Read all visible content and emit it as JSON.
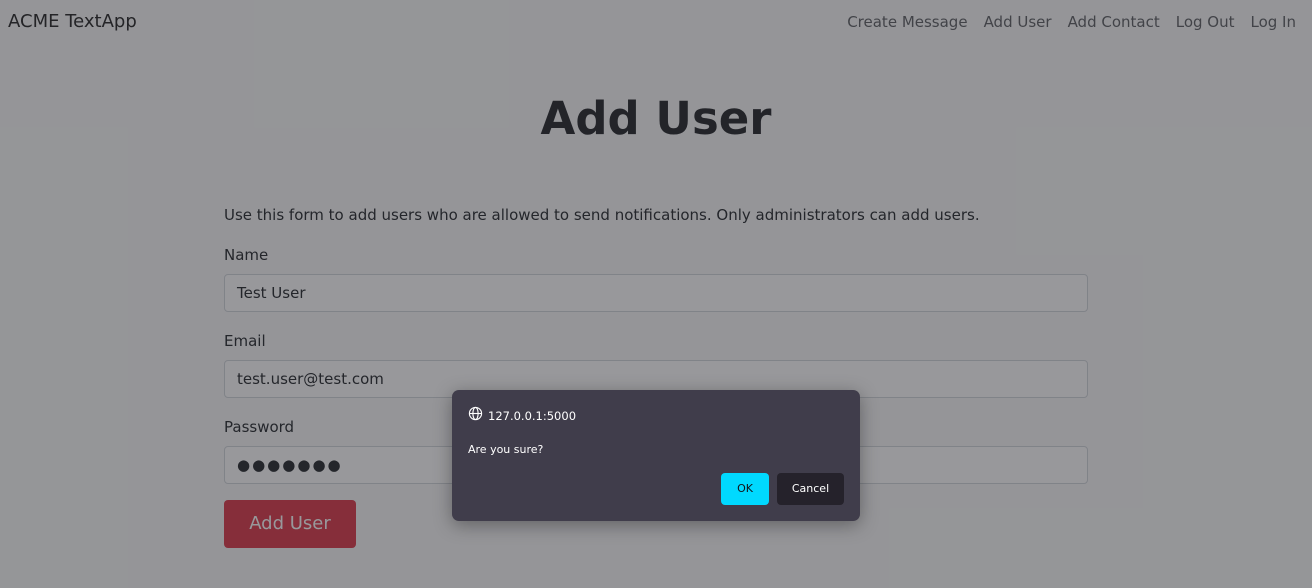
{
  "navbar": {
    "brand": "ACME TextApp",
    "links": [
      "Create Message",
      "Add User",
      "Add Contact",
      "Log Out",
      "Log In"
    ]
  },
  "page": {
    "title": "Add User",
    "intro": "Use this form to add users who are allowed to send notifications. Only administrators can add users."
  },
  "form": {
    "name_label": "Name",
    "name_value": "Test User",
    "email_label": "Email",
    "email_value": "test.user@test.com",
    "password_label": "Password",
    "password_mask": "●●●●●●●",
    "submit_label": "Add User"
  },
  "dialog": {
    "origin": "127.0.0.1:5000",
    "message": "Are you sure?",
    "ok_label": "OK",
    "cancel_label": "Cancel",
    "origin_icon": "globe-icon"
  },
  "colors": {
    "submit_button": "#dc3545",
    "dialog_background": "#403d4b",
    "ok_button": "#00d9ff",
    "cancel_button": "#25222b"
  }
}
